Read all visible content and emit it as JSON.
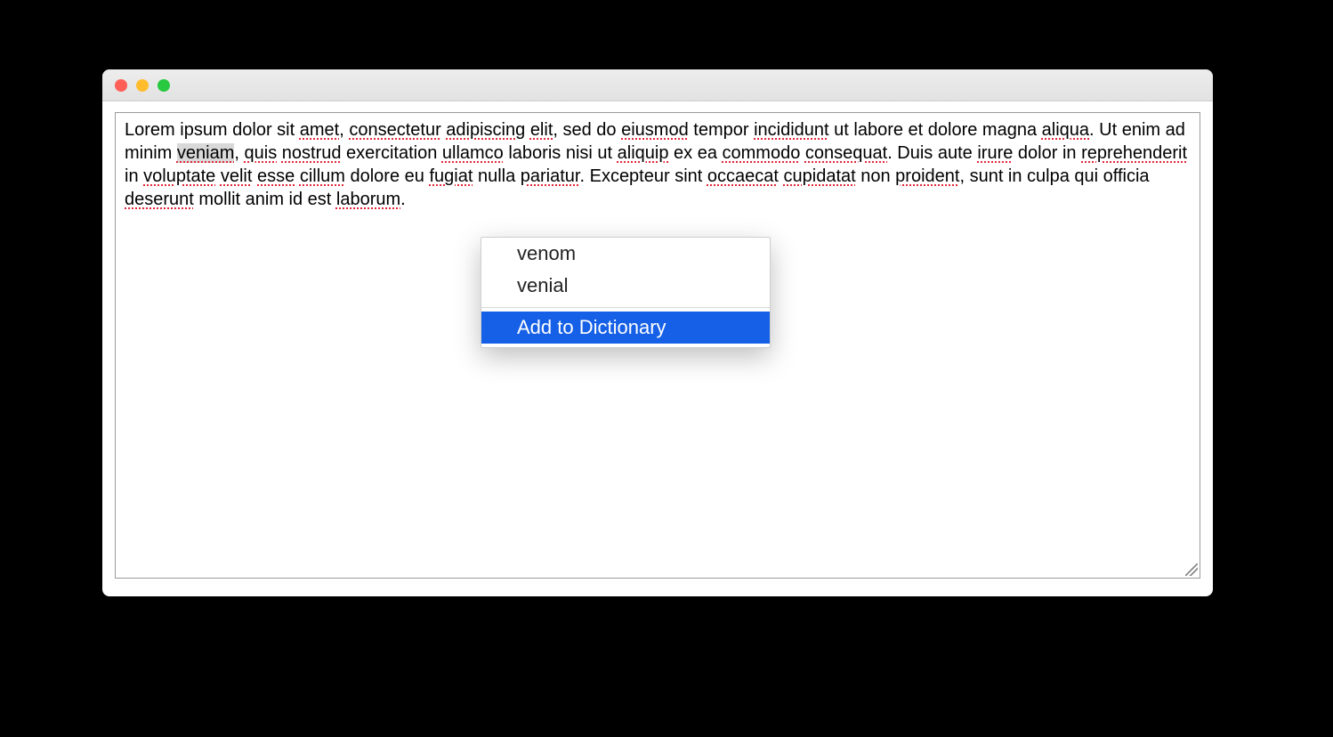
{
  "textarea": {
    "segments": [
      {
        "t": "Lorem ipsum dolor sit ",
        "c": ""
      },
      {
        "t": "amet",
        "c": "spell"
      },
      {
        "t": ", ",
        "c": ""
      },
      {
        "t": "consectetur",
        "c": "spell"
      },
      {
        "t": " ",
        "c": ""
      },
      {
        "t": "adipiscing",
        "c": "spell"
      },
      {
        "t": " ",
        "c": ""
      },
      {
        "t": "elit",
        "c": "spell"
      },
      {
        "t": ", sed do ",
        "c": ""
      },
      {
        "t": "eiusmod",
        "c": "spell"
      },
      {
        "t": " tempor ",
        "c": ""
      },
      {
        "t": "incididunt",
        "c": "spell"
      },
      {
        "t": " ut labore et dolore magna ",
        "c": ""
      },
      {
        "t": "aliqua",
        "c": "spell"
      },
      {
        "t": ". Ut enim ad minim ",
        "c": ""
      },
      {
        "t": "veniam",
        "c": "spell sel"
      },
      {
        "t": ", ",
        "c": ""
      },
      {
        "t": "quis",
        "c": "spell"
      },
      {
        "t": " ",
        "c": ""
      },
      {
        "t": "nostrud",
        "c": "spell"
      },
      {
        "t": " exercitation ",
        "c": ""
      },
      {
        "t": "ullamco",
        "c": "spell"
      },
      {
        "t": " laboris nisi ut ",
        "c": ""
      },
      {
        "t": "aliquip",
        "c": "spell"
      },
      {
        "t": " ex ea ",
        "c": ""
      },
      {
        "t": "commodo",
        "c": "spell"
      },
      {
        "t": " ",
        "c": ""
      },
      {
        "t": "consequat",
        "c": "spell"
      },
      {
        "t": ". Duis aute ",
        "c": ""
      },
      {
        "t": "irure",
        "c": "spell"
      },
      {
        "t": " dolor in ",
        "c": ""
      },
      {
        "t": "reprehenderit",
        "c": "spell"
      },
      {
        "t": " in ",
        "c": ""
      },
      {
        "t": "voluptate",
        "c": "spell"
      },
      {
        "t": " ",
        "c": ""
      },
      {
        "t": "velit",
        "c": "spell"
      },
      {
        "t": " ",
        "c": ""
      },
      {
        "t": "esse",
        "c": "spell"
      },
      {
        "t": " ",
        "c": ""
      },
      {
        "t": "cillum",
        "c": "spell"
      },
      {
        "t": " dolore eu ",
        "c": ""
      },
      {
        "t": "fugiat",
        "c": "spell"
      },
      {
        "t": " nulla ",
        "c": ""
      },
      {
        "t": "pariatur",
        "c": "spell"
      },
      {
        "t": ". Excepteur sint ",
        "c": ""
      },
      {
        "t": "occaecat",
        "c": "spell"
      },
      {
        "t": " ",
        "c": ""
      },
      {
        "t": "cupidatat",
        "c": "spell"
      },
      {
        "t": " non ",
        "c": ""
      },
      {
        "t": "proident",
        "c": "spell"
      },
      {
        "t": ", sunt in culpa qui officia ",
        "c": ""
      },
      {
        "t": "deserunt",
        "c": "spell"
      },
      {
        "t": " mollit anim id est ",
        "c": ""
      },
      {
        "t": "laborum",
        "c": "spell"
      },
      {
        "t": ".",
        "c": ""
      }
    ]
  },
  "context_menu": {
    "suggestions": [
      "venom",
      "venial"
    ],
    "add_label": "Add to Dictionary"
  }
}
